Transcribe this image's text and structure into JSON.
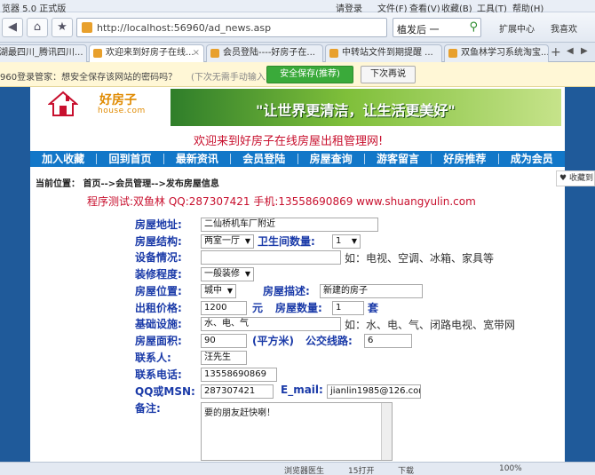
{
  "browser": {
    "title": "览器 5.0 正式版",
    "login": "请登录",
    "menu": [
      "文件(F)",
      "查看(V)",
      "收藏(B)",
      "工具(T)",
      "帮助(H)"
    ],
    "back": "◀",
    "forward": "▶",
    "home": "⌂",
    "star": "★",
    "url": "http://localhost:56960/ad_news.asp",
    "search_query": "植发后 一",
    "extensions": "扩展中心",
    "want_fav": "我喜欢",
    "tabs": [
      {
        "label": "湖最四川_腾讯四川..."
      },
      {
        "label": "欢迎来到好房子在线..."
      },
      {
        "label": "会员登陆----好房子在..."
      },
      {
        "label": "中转站文件到期提醒 ..."
      },
      {
        "label": "双鱼林学习系统淘宝..."
      }
    ],
    "password_bar": {
      "message": "960登录管家：想安全保存该网站的密码吗？",
      "hint": "(下次无需手动输入)",
      "save": "安全保存(推荐)",
      "later": "下次再说"
    },
    "side_fav": "收藏到",
    "status": {
      "left": "浏览器医生",
      "mid": "15打开",
      "download": "下载",
      "zoom": "100%"
    }
  },
  "site": {
    "logo_name": "好房子",
    "logo_sub": "house.com",
    "slogan": "\"让世界更清洁，让生活更美好\"",
    "welcome": "欢迎来到好房子在线房屋出租管理网!",
    "nav": [
      "加入收藏",
      "回到首页",
      "最新资讯",
      "会员登陆",
      "房屋查询",
      "游客留言",
      "好房推荐",
      "成为会员"
    ],
    "location": "当前位置： 首页-->会员管理-->发布房屋信息",
    "tester": "程序测试:双鱼林 QQ:287307421 手机:13558690869 www.shuangyulin.com"
  },
  "form": {
    "address_label": "房屋地址:",
    "address": "二仙桥机车厂附近",
    "structure_label": "房屋结构:",
    "structure": "两室一厅",
    "bathroom_label": "卫生间数量:",
    "bathroom": "1",
    "facilities_label": "设备情况:",
    "facilities": "",
    "facilities_note": "如：电视、空调、冰箱、家具等",
    "decoration_label": "装修程度:",
    "decoration": "一般装修",
    "position_label": "房屋位置:",
    "position": "城中",
    "desc_label": "房屋描述:",
    "desc": "新建的房子",
    "price_label": "出租价格:",
    "price": "1200",
    "price_unit": "元",
    "qty_label": "房屋数量:",
    "qty": "1",
    "qty_unit": "套",
    "infra_label": "基础设施:",
    "infra": "水、电、气",
    "infra_note": "如：水、电、气、闭路电视、宽带网",
    "area_label": "房屋面积:",
    "area": "90",
    "area_unit": "(平方米)",
    "bus_label": "公交线路:",
    "bus": "6",
    "contact_label": "联系人:",
    "contact": "汪先生",
    "phone_label": "联系电话:",
    "phone": "13558690869",
    "qq_label": "QQ或MSN:",
    "qq": "287307421",
    "email_label": "E_mail:",
    "email": "jianlin1985@126.com",
    "remark_label": "备注:",
    "remark": "要的朋友赶快喇！"
  }
}
